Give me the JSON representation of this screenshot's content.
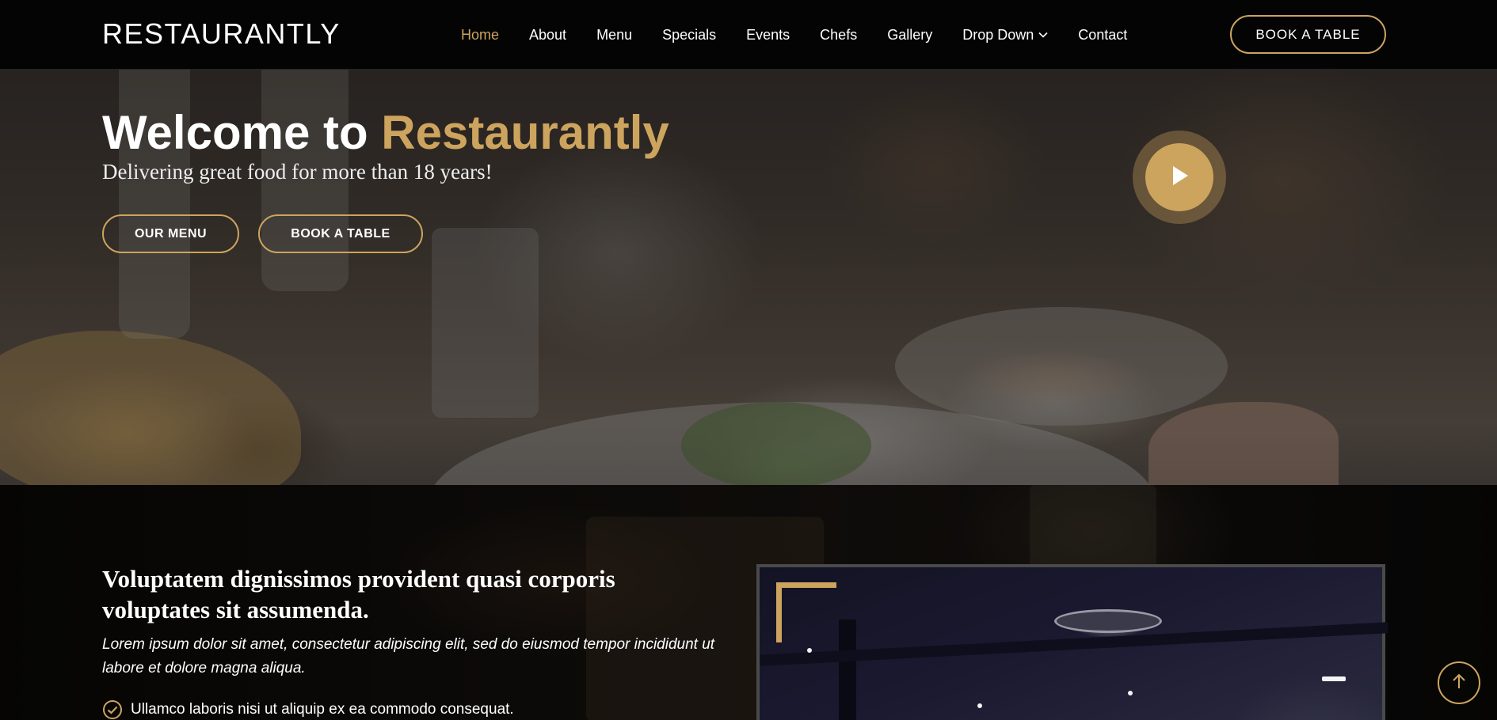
{
  "header": {
    "logo": "RESTAURANTLY",
    "nav": [
      {
        "label": "Home",
        "active": true
      },
      {
        "label": "About",
        "active": false
      },
      {
        "label": "Menu",
        "active": false
      },
      {
        "label": "Specials",
        "active": false
      },
      {
        "label": "Events",
        "active": false
      },
      {
        "label": "Chefs",
        "active": false
      },
      {
        "label": "Gallery",
        "active": false
      },
      {
        "label": "Drop Down",
        "active": false,
        "has_dropdown": true
      },
      {
        "label": "Contact",
        "active": false
      }
    ],
    "book_button": "BOOK A TABLE"
  },
  "hero": {
    "title_prefix": "Welcome to ",
    "title_accent": "Restaurantly",
    "subtitle": "Delivering great food for more than 18 years!",
    "menu_button": "OUR MENU",
    "book_button": "BOOK A TABLE",
    "play_icon": "play-icon"
  },
  "about": {
    "title": "Voluptatem dignissimos provident quasi corporis voluptates sit assumenda.",
    "text": "Lorem ipsum dolor sit amet, consectetur adipiscing elit, sed do eiusmod tempor incididunt ut labore et dolore magna aliqua.",
    "checklist": [
      "Ullamco laboris nisi ut aliquip ex ea commodo consequat."
    ]
  },
  "colors": {
    "accent": "#cda45e",
    "header_bg": "#0c0b09",
    "text": "#ffffff"
  },
  "icons": {
    "dropdown": "chevron-down-icon",
    "check": "check-circle-icon",
    "back_to_top": "arrow-up-icon"
  }
}
